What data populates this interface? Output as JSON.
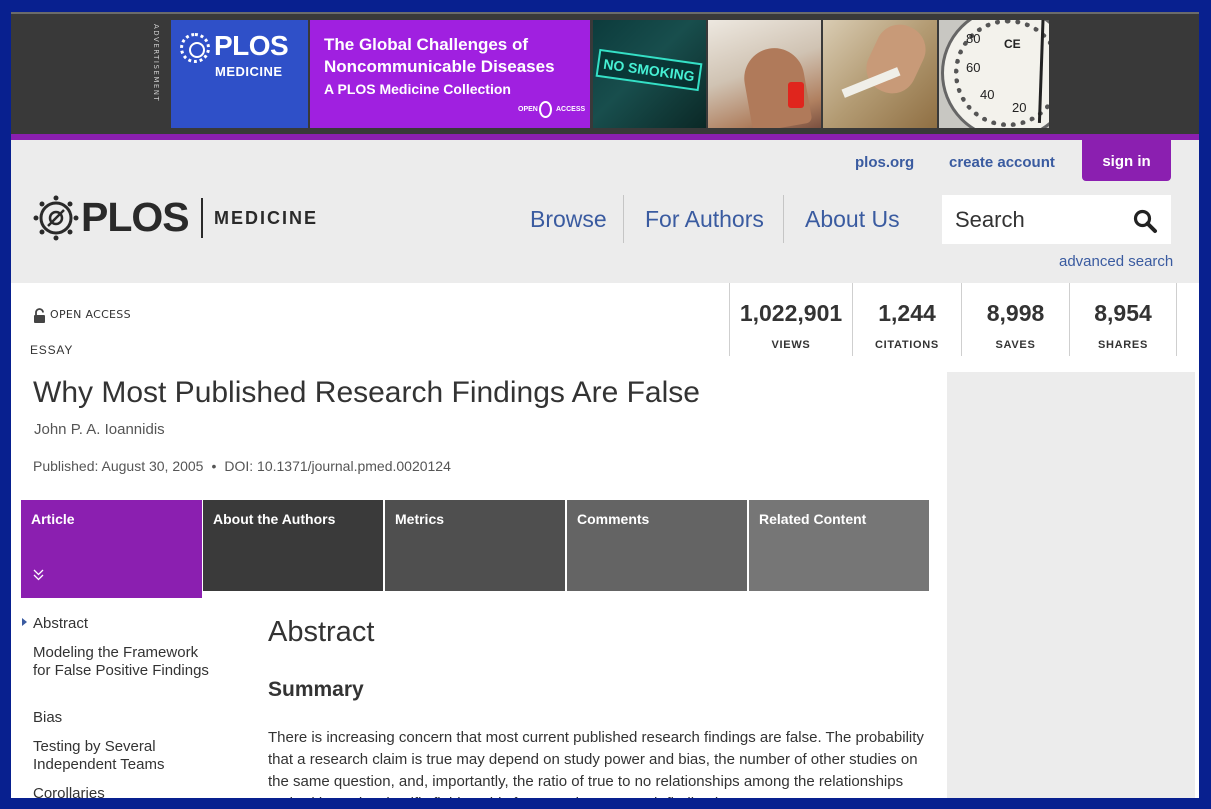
{
  "ad": {
    "vertical_label": "ADVERTISEMENT",
    "logo_word": "PLOS",
    "logo_sub": "MEDICINE",
    "headline_line1": "The Global Challenges of",
    "headline_line2": "Noncommunicable Diseases",
    "headline_line3": "A PLOS Medicine Collection",
    "open_access_left": "OPEN",
    "open_access_right": "ACCESS",
    "photo1_sign": "NO SMOKING",
    "gauge_labels": [
      "80",
      "60",
      "40",
      "20"
    ],
    "gauge_mark": "CE",
    "colors": {
      "banner_bg": "#393939",
      "plos_blue": "#2f50c8",
      "purple": "#a020e0"
    }
  },
  "header": {
    "utility": {
      "plos_org": "plos.org",
      "create_account": "create account",
      "sign_in": "sign in"
    },
    "logo": {
      "word": "PLOS",
      "journal": "MEDICINE"
    },
    "nav": [
      "Browse",
      "For Authors",
      "About Us"
    ],
    "search": {
      "placeholder": "Search",
      "advanced": "advanced search"
    },
    "colors": {
      "accent": "#8b1fb0",
      "link": "#3a5ba0",
      "bg": "#ececec"
    }
  },
  "article": {
    "open_access": "OPEN ACCESS",
    "type": "ESSAY",
    "metrics": [
      {
        "value": "1,022,901",
        "label": "VIEWS"
      },
      {
        "value": "1,244",
        "label": "CITATIONS"
      },
      {
        "value": "8,998",
        "label": "SAVES"
      },
      {
        "value": "8,954",
        "label": "SHARES"
      }
    ],
    "title": "Why Most Published Research Findings Are False",
    "author": "John P. A. Ioannidis",
    "published": "Published: August 30, 2005",
    "separator": "•",
    "doi": "DOI: 10.1371/journal.pmed.0020124"
  },
  "tabs": [
    "Article",
    "About the Authors",
    "Metrics",
    "Comments",
    "Related Content"
  ],
  "toc": [
    "Abstract",
    "Modeling the Framework for False Positive Findings",
    "Bias",
    "Testing by Several Independent Teams",
    "Corollaries"
  ],
  "content": {
    "abstract_heading": "Abstract",
    "summary_heading": "Summary",
    "summary_text": "There is increasing concern that most current published research findings are false. The probability that a research claim is true may depend on study power and bias, the number of other studies on the same question, and, importantly, the ratio of true to no relationships among the relationships probed in each scientific field. In this framework, a research finding is"
  }
}
